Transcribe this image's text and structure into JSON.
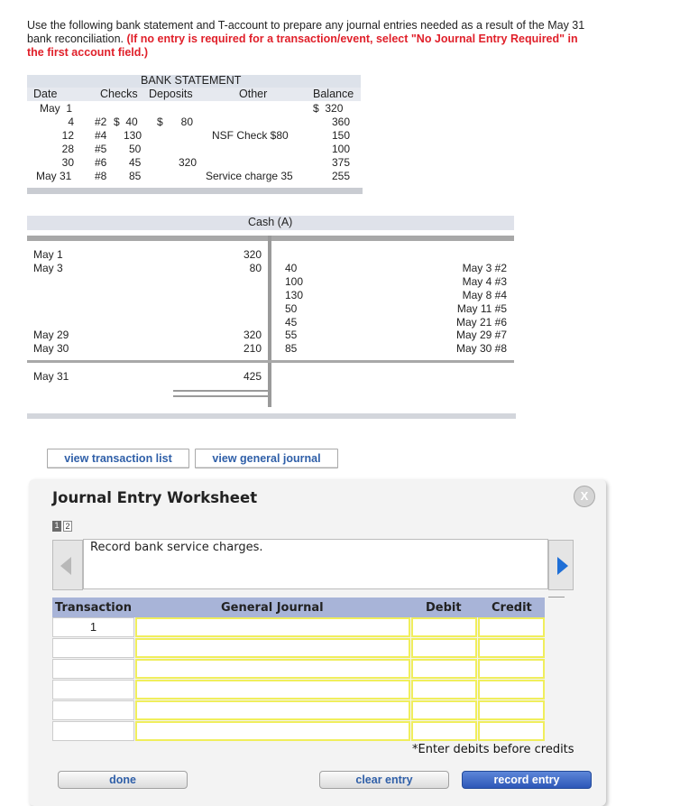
{
  "instructions": {
    "text": "Use the following bank statement and T-account to prepare any journal entries needed as a result of the May 31 bank reconciliation.",
    "note": "(If no entry is required for a transaction/event, select \"No Journal Entry Required\" in the first account field.)"
  },
  "bank_statement": {
    "title": "BANK STATEMENT",
    "headers": {
      "date": "Date",
      "checks": "Checks",
      "deposits": "Deposits",
      "other": "Other",
      "balance": "Balance"
    },
    "rows": [
      {
        "date": "May  1",
        "check_no": "",
        "check_amt": "",
        "deposit": "",
        "other": "",
        "balance": "$  320"
      },
      {
        "date": "4",
        "check_no": "#2",
        "check_amt": "$  40",
        "deposit": "$      80",
        "other": "",
        "balance": "360"
      },
      {
        "date": "12",
        "check_no": "#4",
        "check_amt": "130",
        "deposit": "",
        "other": "NSF Check $80",
        "balance": "150"
      },
      {
        "date": "28",
        "check_no": "#5",
        "check_amt": "50",
        "deposit": "",
        "other": "",
        "balance": "100"
      },
      {
        "date": "30",
        "check_no": "#6",
        "check_amt": "45",
        "deposit": "320",
        "other": "",
        "balance": "375"
      },
      {
        "date": "May 31",
        "check_no": "#8",
        "check_amt": "85",
        "deposit": "",
        "other": "Service charge 35",
        "balance": "255"
      }
    ]
  },
  "t_account": {
    "title": "Cash (A)",
    "debits": [
      {
        "label": "May 1",
        "amount": "320"
      },
      {
        "label": "May 3",
        "amount": "80"
      },
      {
        "label": "May 29",
        "amount": "320"
      },
      {
        "label": "May 30",
        "amount": "210"
      }
    ],
    "credits": [
      {
        "amount": "40",
        "label": "May 3 #2"
      },
      {
        "amount": "100",
        "label": "May 4 #3"
      },
      {
        "amount": "130",
        "label": "May 8 #4"
      },
      {
        "amount": "50",
        "label": "May 11 #5"
      },
      {
        "amount": "45",
        "label": "May 21 #6"
      },
      {
        "amount": "55",
        "label": "May 29 #7"
      },
      {
        "amount": "85",
        "label": "May 30 #8"
      }
    ],
    "ending": {
      "label": "May 31",
      "amount": "425"
    }
  },
  "buttons": {
    "view_transactions": "view transaction list",
    "view_journal": "view general journal"
  },
  "worksheet": {
    "title": "Journal Entry Worksheet",
    "close_label": "X",
    "pages": [
      "1",
      "2"
    ],
    "description": "Record bank service charges.",
    "columns": {
      "transaction": "Transaction",
      "general_journal": "General Journal",
      "debit": "Debit",
      "credit": "Credit"
    },
    "transaction_number": "1",
    "note": "*Enter debits before credits",
    "done": "done",
    "clear": "clear entry",
    "record": "record entry"
  }
}
